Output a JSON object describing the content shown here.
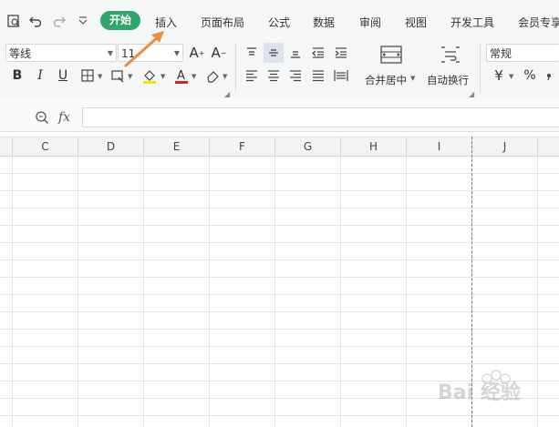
{
  "tabs": {
    "start": "开始",
    "insert": "插入",
    "page_layout": "页面布局",
    "formulas": "公式",
    "data": "数据",
    "review": "审阅",
    "view": "视图",
    "developer": "开发工具",
    "member": "会员专享"
  },
  "font": {
    "name": "等线",
    "size": "11"
  },
  "ribbon": {
    "merge_center": "合并居中",
    "wrap_text": "自动换行",
    "number_format": "常规",
    "currency_symbol": "¥",
    "percent_symbol": "%"
  },
  "formula_bar": {
    "fx": "fx",
    "value": ""
  },
  "columns": [
    "C",
    "D",
    "E",
    "F",
    "G",
    "H",
    "I",
    "J"
  ],
  "watermark": {
    "text": "Bai 经验"
  },
  "colors": {
    "active_tab": "#2ea66a",
    "annotation_arrow": "#f08a3c",
    "font_color_underline": "#e02020",
    "fill_color_underline": "#f5e400"
  }
}
